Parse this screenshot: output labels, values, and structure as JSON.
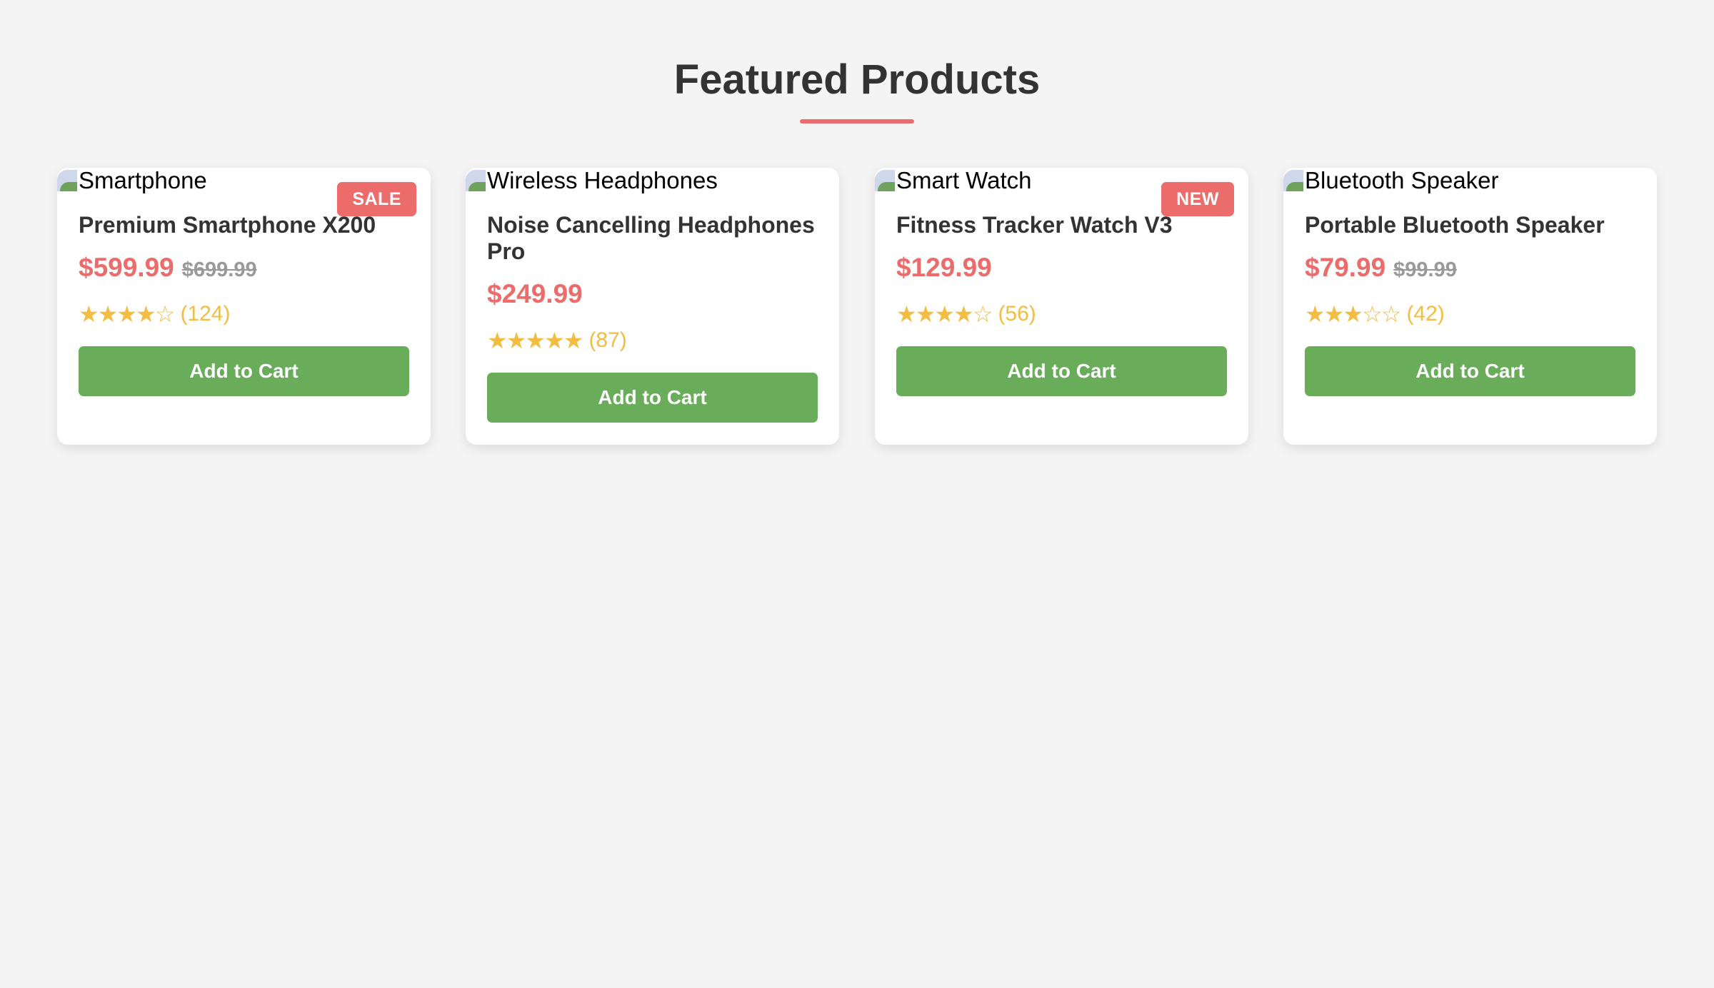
{
  "page": {
    "title": "Featured Products"
  },
  "colors": {
    "background": "#f4f4f4",
    "accent": "#ec6b6b",
    "button": "#69ad5b",
    "star": "#f3bd42",
    "text": "#333333",
    "old_price": "#999999"
  },
  "products": [
    {
      "image_alt": "Smartphone",
      "badge": "SALE",
      "name": "Premium Smartphone X200",
      "price": "$599.99",
      "old_price": "$699.99",
      "stars": "★★★★☆",
      "rating": 4,
      "reviews": "(124)",
      "button_label": "Add to Cart"
    },
    {
      "image_alt": "Wireless Headphones",
      "badge": "",
      "name": "Noise Cancelling Headphones Pro",
      "price": "$249.99",
      "old_price": "",
      "stars": "★★★★★",
      "rating": 5,
      "reviews": "(87)",
      "button_label": "Add to Cart"
    },
    {
      "image_alt": "Smart Watch",
      "badge": "NEW",
      "name": "Fitness Tracker Watch V3",
      "price": "$129.99",
      "old_price": "",
      "stars": "★★★★☆",
      "rating": 4,
      "reviews": "(56)",
      "button_label": "Add to Cart"
    },
    {
      "image_alt": "Bluetooth Speaker",
      "badge": "",
      "name": "Portable Bluetooth Speaker",
      "price": "$79.99",
      "old_price": "$99.99",
      "stars": "★★★☆☆",
      "rating": 3,
      "reviews": "(42)",
      "button_label": "Add to Cart"
    }
  ]
}
